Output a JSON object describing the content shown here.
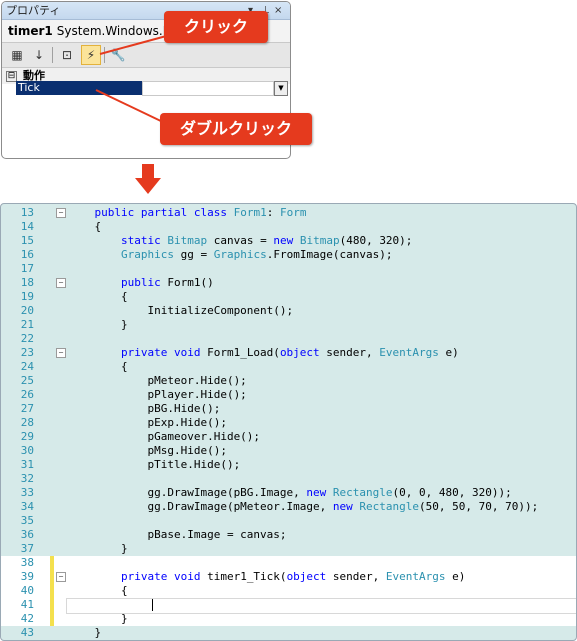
{
  "properties": {
    "title": "プロパティ",
    "title_controls": "▾ ⊥ ×",
    "object_name": "timer1",
    "object_type": "System.Windows.Form",
    "category": "動作",
    "category_toggle": "⊟",
    "property_name": "Tick",
    "property_value": "",
    "toolbar": [
      "categorized-icon",
      "alphabetical-icon",
      "properties-icon",
      "events-icon",
      "property-pages-icon"
    ]
  },
  "callouts": {
    "click": "クリック",
    "double_click": "ダブルクリック",
    "color": "#e53a1e"
  },
  "editor": {
    "lines": [
      {
        "n": "13",
        "fold": "⊟",
        "tokens": [
          [
            "",
            "    "
          ],
          [
            "kw",
            "public partial class "
          ],
          [
            "type",
            "Form1"
          ],
          [
            "",
            ": "
          ],
          [
            "type",
            "Form"
          ]
        ]
      },
      {
        "n": "14",
        "fold": "",
        "tokens": [
          [
            "",
            "    {"
          ]
        ]
      },
      {
        "n": "15",
        "fold": "",
        "tokens": [
          [
            "",
            "        "
          ],
          [
            "kw",
            "static "
          ],
          [
            "type",
            "Bitmap"
          ],
          [
            "",
            " canvas = "
          ],
          [
            "kw",
            "new "
          ],
          [
            "type",
            "Bitmap"
          ],
          [
            "",
            "(480, 320);"
          ]
        ]
      },
      {
        "n": "16",
        "fold": "",
        "tokens": [
          [
            "",
            "        "
          ],
          [
            "type",
            "Graphics"
          ],
          [
            "",
            " gg = "
          ],
          [
            "type",
            "Graphics"
          ],
          [
            "",
            ".FromImage(canvas);"
          ]
        ]
      },
      {
        "n": "17",
        "fold": "",
        "tokens": [
          [
            "",
            ""
          ]
        ]
      },
      {
        "n": "18",
        "fold": "⊟",
        "tokens": [
          [
            "",
            "        "
          ],
          [
            "kw",
            "public "
          ],
          [
            "",
            "Form1()"
          ]
        ]
      },
      {
        "n": "19",
        "fold": "",
        "tokens": [
          [
            "",
            "        {"
          ]
        ]
      },
      {
        "n": "20",
        "fold": "",
        "tokens": [
          [
            "",
            "            InitializeComponent();"
          ]
        ]
      },
      {
        "n": "21",
        "fold": "",
        "tokens": [
          [
            "",
            "        }"
          ]
        ]
      },
      {
        "n": "22",
        "fold": "",
        "tokens": [
          [
            "",
            ""
          ]
        ]
      },
      {
        "n": "23",
        "fold": "⊟",
        "tokens": [
          [
            "",
            "        "
          ],
          [
            "kw",
            "private void "
          ],
          [
            "",
            "Form1_Load("
          ],
          [
            "kw",
            "object "
          ],
          [
            "",
            "sender, "
          ],
          [
            "type",
            "EventArgs"
          ],
          [
            "",
            " e)"
          ]
        ]
      },
      {
        "n": "24",
        "fold": "",
        "tokens": [
          [
            "",
            "        {"
          ]
        ]
      },
      {
        "n": "25",
        "fold": "",
        "tokens": [
          [
            "",
            "            pMeteor.Hide();"
          ]
        ]
      },
      {
        "n": "26",
        "fold": "",
        "tokens": [
          [
            "",
            "            pPlayer.Hide();"
          ]
        ]
      },
      {
        "n": "27",
        "fold": "",
        "tokens": [
          [
            "",
            "            pBG.Hide();"
          ]
        ]
      },
      {
        "n": "28",
        "fold": "",
        "tokens": [
          [
            "",
            "            pExp.Hide();"
          ]
        ]
      },
      {
        "n": "29",
        "fold": "",
        "tokens": [
          [
            "",
            "            pGameover.Hide();"
          ]
        ]
      },
      {
        "n": "30",
        "fold": "",
        "tokens": [
          [
            "",
            "            pMsg.Hide();"
          ]
        ]
      },
      {
        "n": "31",
        "fold": "",
        "tokens": [
          [
            "",
            "            pTitle.Hide();"
          ]
        ]
      },
      {
        "n": "32",
        "fold": "",
        "tokens": [
          [
            "",
            ""
          ]
        ]
      },
      {
        "n": "33",
        "fold": "",
        "tokens": [
          [
            "",
            "            gg.DrawImage(pBG.Image, "
          ],
          [
            "kw",
            "new "
          ],
          [
            "type",
            "Rectangle"
          ],
          [
            "",
            "(0, 0, 480, 320));"
          ]
        ]
      },
      {
        "n": "34",
        "fold": "",
        "tokens": [
          [
            "",
            "            gg.DrawImage(pMeteor.Image, "
          ],
          [
            "kw",
            "new "
          ],
          [
            "type",
            "Rectangle"
          ],
          [
            "",
            "(50, 50, 70, 70));"
          ]
        ]
      },
      {
        "n": "35",
        "fold": "",
        "tokens": [
          [
            "",
            ""
          ]
        ]
      },
      {
        "n": "36",
        "fold": "",
        "tokens": [
          [
            "",
            "            pBase.Image = canvas;"
          ]
        ]
      },
      {
        "n": "37",
        "fold": "",
        "tokens": [
          [
            "",
            "        }"
          ]
        ]
      },
      {
        "n": "38",
        "fold": "",
        "tokens": [
          [
            "",
            ""
          ]
        ]
      },
      {
        "n": "39",
        "fold": "⊟",
        "tokens": [
          [
            "",
            "        "
          ],
          [
            "kw",
            "private void "
          ],
          [
            "",
            "timer1_Tick("
          ],
          [
            "kw",
            "object "
          ],
          [
            "",
            "sender, "
          ],
          [
            "type",
            "EventArgs"
          ],
          [
            "",
            " e)"
          ]
        ]
      },
      {
        "n": "40",
        "fold": "",
        "tokens": [
          [
            "",
            "        {"
          ]
        ]
      },
      {
        "n": "41",
        "fold": "",
        "tokens": [
          [
            "",
            ""
          ]
        ]
      },
      {
        "n": "42",
        "fold": "",
        "tokens": [
          [
            "",
            "        }"
          ]
        ]
      },
      {
        "n": "43",
        "fold": "",
        "tokens": [
          [
            "",
            "    }"
          ]
        ]
      }
    ],
    "changed_lines": [
      "38",
      "39",
      "40",
      "41",
      "42"
    ],
    "light_lines": [
      "38",
      "39",
      "40",
      "41",
      "42"
    ],
    "colors": {
      "keyword": "#0000ff",
      "type": "#2b91af",
      "line_number": "#2b91af",
      "background": "#d6eae9",
      "change_marker": "#f4e04d"
    }
  }
}
